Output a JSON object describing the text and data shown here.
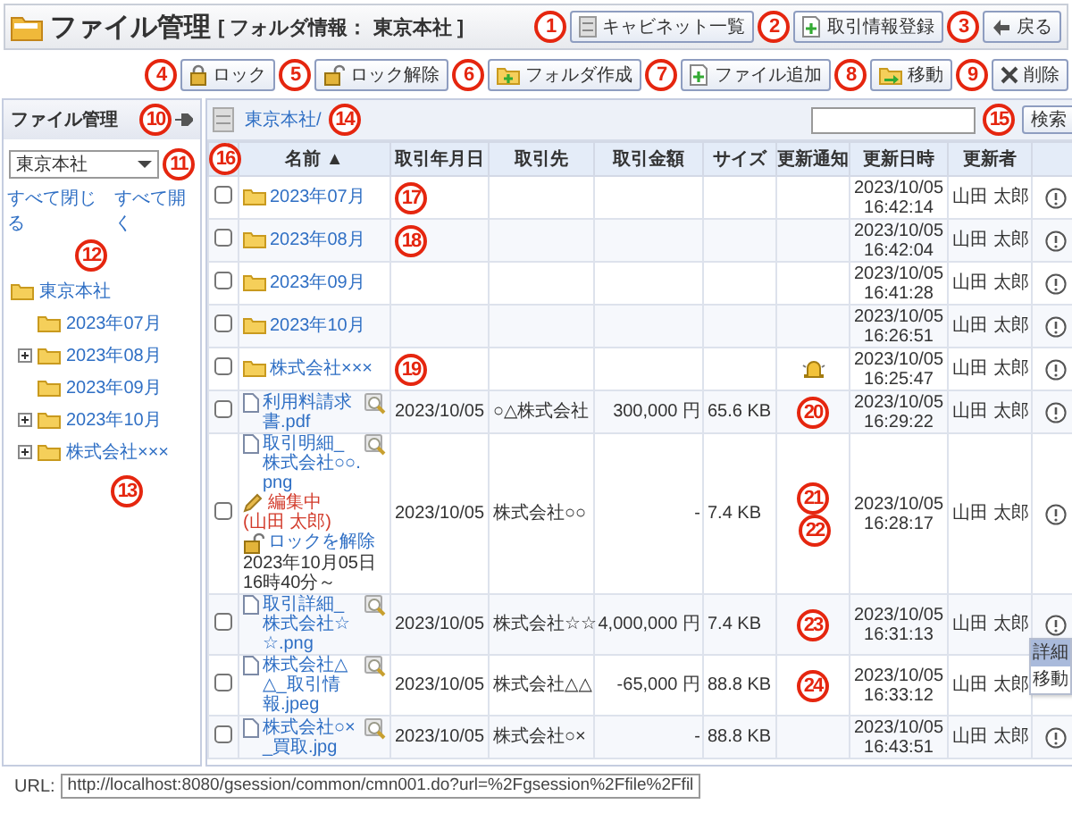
{
  "header": {
    "title": "ファイル管理",
    "folder_info": "[ フォルダ情報： 東京本社 ]",
    "buttons": [
      {
        "label": "キャビネット一覧"
      },
      {
        "label": "取引情報登録"
      },
      {
        "label": "戻る"
      }
    ]
  },
  "toolbar": {
    "buttons": [
      {
        "label": "ロック"
      },
      {
        "label": "ロック解除"
      },
      {
        "label": "フォルダ作成"
      },
      {
        "label": "ファイル追加"
      },
      {
        "label": "移動"
      },
      {
        "label": "削除"
      }
    ]
  },
  "sidebar": {
    "title": "ファイル管理",
    "cabinet_select": "東京本社",
    "collapse_all": "すべて閉じる",
    "expand_all": "すべて開く",
    "tree": [
      {
        "label": "東京本社",
        "children": [
          {
            "label": "2023年07月",
            "expandable": false
          },
          {
            "label": "2023年08月",
            "expandable": true
          },
          {
            "label": "2023年09月",
            "expandable": false
          },
          {
            "label": "2023年10月",
            "expandable": true
          },
          {
            "label": "株式会社×××",
            "expandable": true
          }
        ]
      }
    ]
  },
  "path": "東京本社/",
  "search": {
    "button": "検索"
  },
  "table": {
    "columns": [
      "名前 ▲",
      "取引年月日",
      "取引先",
      "取引金額",
      "サイズ",
      "更新通知",
      "更新日時",
      "更新者"
    ],
    "rows": [
      {
        "kind": "folder",
        "checked": false,
        "menu_open": false,
        "name": "2023年07月",
        "notify": false,
        "updated_date": "2023/10/05",
        "updated_time": "16:42:14",
        "updater": "山田 太郎"
      },
      {
        "kind": "folder",
        "checked": false,
        "menu_open": false,
        "name": "2023年08月",
        "notify": false,
        "updated_date": "2023/10/05",
        "updated_time": "16:42:04",
        "updater": "山田 太郎"
      },
      {
        "kind": "folder",
        "checked": false,
        "menu_open": false,
        "name": "2023年09月",
        "notify": false,
        "updated_date": "2023/10/05",
        "updated_time": "16:41:28",
        "updater": "山田 太郎"
      },
      {
        "kind": "folder",
        "checked": false,
        "menu_open": false,
        "name": "2023年10月",
        "notify": false,
        "updated_date": "2023/10/05",
        "updated_time": "16:26:51",
        "updater": "山田 太郎"
      },
      {
        "kind": "folder",
        "checked": false,
        "menu_open": false,
        "name": "株式会社×××",
        "notify": true,
        "updated_date": "2023/10/05",
        "updated_time": "16:25:47",
        "updater": "山田 太郎"
      },
      {
        "kind": "file",
        "checked": false,
        "menu_open": false,
        "name": "利用料請求書.pdf",
        "date": "2023/10/05",
        "partner": "○△株式会社",
        "amount": "300,000 円",
        "size": "65.6 KB",
        "notify": false,
        "updated_date": "2023/10/05",
        "updated_time": "16:29:22",
        "updater": "山田 太郎"
      },
      {
        "kind": "file",
        "checked": false,
        "menu_open": false,
        "name": "取引明細_株式会社○○.png",
        "editing": "編集中",
        "editing_user": "(山田 太郎)",
        "unlock": "ロックを解除",
        "lock_time": "2023年10月05日16時40分～",
        "date": "2023/10/05",
        "partner": "株式会社○○",
        "amount": "-",
        "size": "7.4 KB",
        "notify": false,
        "updated_date": "2023/10/05",
        "updated_time": "16:28:17",
        "updater": "山田 太郎"
      },
      {
        "kind": "file",
        "checked": false,
        "menu_open": true,
        "name": "取引詳細_株式会社☆☆.png",
        "date": "2023/10/05",
        "partner": "株式会社☆☆",
        "amount": "4,000,000 円",
        "size": "7.4 KB",
        "notify": false,
        "updated_date": "2023/10/05",
        "updated_time": "16:31:13",
        "updater": "山田 太郎"
      },
      {
        "kind": "file",
        "checked": false,
        "menu_open": false,
        "name": "株式会社△△_取引情報.jpeg",
        "date": "2023/10/05",
        "partner": "株式会社△△",
        "amount": "-65,000 円",
        "size": "88.8 KB",
        "notify": false,
        "updated_date": "2023/10/05",
        "updated_time": "16:33:12",
        "updater": "山田 太郎"
      },
      {
        "kind": "file",
        "checked": false,
        "menu_open": false,
        "name": "株式会社○×_買取.jpg",
        "date": "2023/10/05",
        "partner": "株式会社○×",
        "amount": "-",
        "size": "88.8 KB",
        "notify": false,
        "updated_date": "2023/10/05",
        "updated_time": "16:43:51",
        "updater": "山田 太郎"
      }
    ]
  },
  "row_menu": {
    "items": [
      {
        "label": "詳細",
        "selected": true
      },
      {
        "label": "移動",
        "selected": false
      }
    ]
  },
  "url": {
    "label": "URL:",
    "value": "http://localhost:8080/gsession/common/cmn001.do?url=%2Fgsession%2Ffile%2Ffil"
  },
  "callouts": [
    "1",
    "2",
    "3",
    "4",
    "5",
    "6",
    "7",
    "8",
    "9",
    "10",
    "11",
    "12",
    "13",
    "14",
    "15",
    "16",
    "17",
    "18",
    "19",
    "20",
    "21",
    "22",
    "23",
    "24"
  ]
}
